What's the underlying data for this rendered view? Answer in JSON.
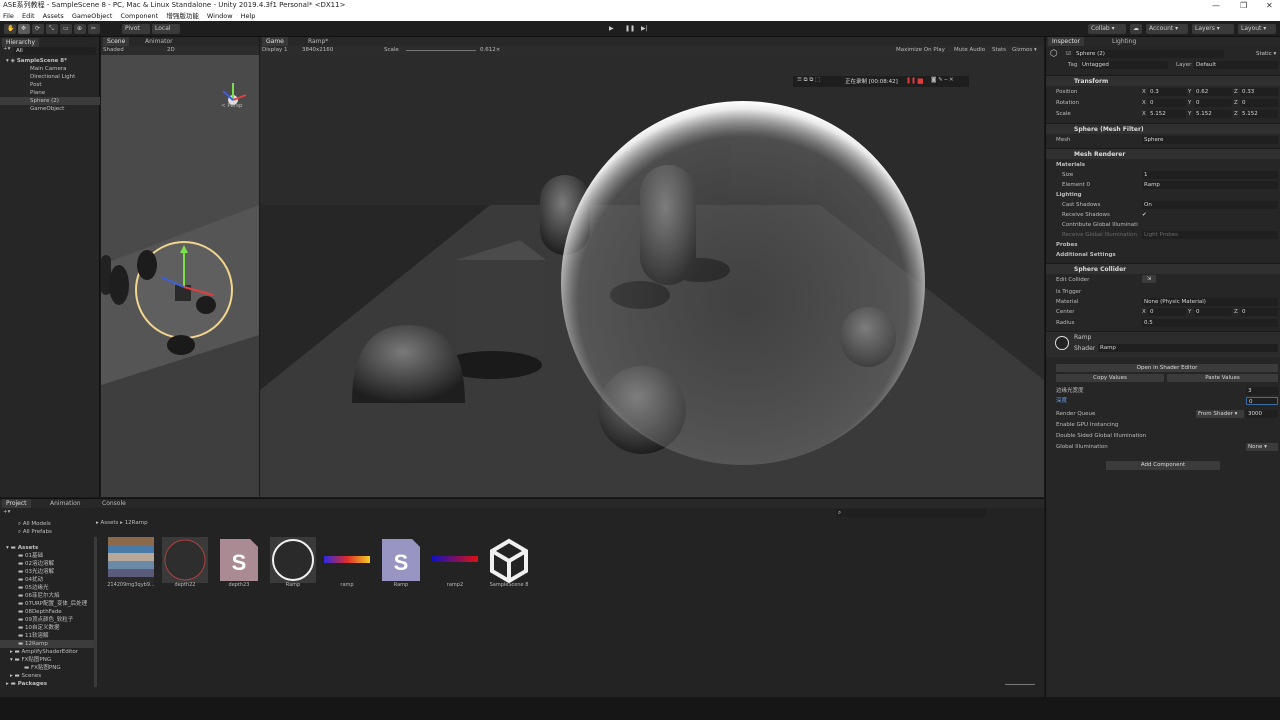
{
  "window": {
    "title": "ASE系列教程 - SampleScene 8 - PC, Mac & Linux Standalone - Unity 2019.4.3f1 Personal* <DX11>"
  },
  "menu": [
    "File",
    "Edit",
    "Assets",
    "GameObject",
    "Component",
    "增强版功能",
    "Window",
    "Help"
  ],
  "toolbar": {
    "pivot": "Pivot",
    "local": "Local",
    "collab": "Collab ▾",
    "account": "Account ▾",
    "layers": "Layers ▾",
    "layout": "Layout ▾"
  },
  "hierarchy": {
    "tab": "Hierarchy",
    "search_placeholder": "All",
    "scene": "SampleScene 8*",
    "items": [
      "Main Camera",
      "Directional Light",
      "Post",
      "Plane",
      "Sphere (2)",
      "GameObject"
    ]
  },
  "scene": {
    "tab": "Scene",
    "tab2": "Animator",
    "shading": "Shaded",
    "mode": "2D",
    "persp": "< Persp"
  },
  "game": {
    "tab": "Game",
    "tab2": "Ramp*",
    "display": "Display 1",
    "resolution": "3840x2160",
    "scale_label": "Scale",
    "scale_value": "0.612×",
    "maximize": "Maximize On Play",
    "mute": "Mute Audio",
    "stats": "Stats",
    "gizmos": "Gizmos ▾",
    "recording": "正在录制 [00:08:42]"
  },
  "inspector": {
    "tab": "Inspector",
    "tab2": "Lighting",
    "name": "Sphere (2)",
    "static": "Static ▾",
    "tag_label": "Tag",
    "tag": "Untagged",
    "layer_label": "Layer",
    "layer": "Default",
    "transform": {
      "title": "Transform",
      "position_label": "Position",
      "rotation_label": "Rotation",
      "scale_label": "Scale",
      "position": [
        "0.3",
        "0.62",
        "0.33"
      ],
      "rotation": [
        "0",
        "0",
        "0"
      ],
      "scale": [
        "5.152",
        "5.152",
        "5.152"
      ]
    },
    "mesh_filter": {
      "title": "Sphere (Mesh Filter)",
      "mesh_label": "Mesh",
      "mesh": "Sphere"
    },
    "mesh_renderer": {
      "title": "Mesh Renderer",
      "materials": "Materials",
      "size_label": "Size",
      "size": "1",
      "element_label": "Element 0",
      "element": "Ramp",
      "lighting": "Lighting",
      "cast_label": "Cast Shadows",
      "cast": "On",
      "receive_label": "Receive Shadows",
      "contribute_label": "Contribute Global Illuminati",
      "receive_gi_label": "Receive Global Illumination",
      "receive_gi": "Light Probes",
      "probes": "Probes",
      "additional": "Additional Settings"
    },
    "collider": {
      "title": "Sphere Collider",
      "edit_label": "Edit Collider",
      "trigger_label": "Is Trigger",
      "material_label": "Material",
      "material": "None (Physic Material)",
      "center_label": "Center",
      "center": [
        "0",
        "0",
        "0"
      ],
      "radius_label": "Radius",
      "radius": "0.5"
    },
    "material": {
      "name": "Ramp",
      "shader_label": "Shader",
      "shader": "Ramp",
      "open_btn": "Open in Shader Editor",
      "copy_btn": "Copy Values",
      "paste_btn": "Paste Values",
      "edge_label": "边缘光宽度",
      "edge_value": "3",
      "depth_label": "深度",
      "depth_value": "0",
      "queue_label": "Render Queue",
      "queue_mode": "From Shader ▾",
      "queue_value": "3000",
      "gpu_label": "Enable GPU Instancing",
      "dsgi_label": "Double Sided Global Illumination",
      "gi_label": "Global Illumination",
      "gi_value": "None ▾"
    },
    "add_component": "Add Component"
  },
  "project": {
    "tab": "Project",
    "tab2": "Animation",
    "tab3": "Console",
    "favorites": [
      "All Models",
      "All Prefabs"
    ],
    "assets_root": "Assets",
    "folders": [
      "01基础",
      "02溶边溶解",
      "03光边溶解",
      "04扰动",
      "05边缘光",
      "06菲尼尔大焰",
      "07URP配置_变体_后处理",
      "08DepthFade",
      "09顶点颜色_软粒子",
      "10自定义数据",
      "11软溶解",
      "12Ramp",
      "AmplifyShaderEditor",
      "FX贴图PNG",
      "FX贴图PNG",
      "Scenes"
    ],
    "packages": "Packages",
    "breadcrumb": [
      "Assets",
      "12Ramp"
    ],
    "assets": [
      "214209mg3qyb9...",
      "depth22",
      "depth23",
      "Ramp",
      "ramp",
      "Ramp",
      "ramp2",
      "SampleScene 8"
    ]
  },
  "colors": {
    "accent": "#3d6ea8",
    "recording_red": "#e23b3b",
    "selection": "#3c3c3c"
  }
}
